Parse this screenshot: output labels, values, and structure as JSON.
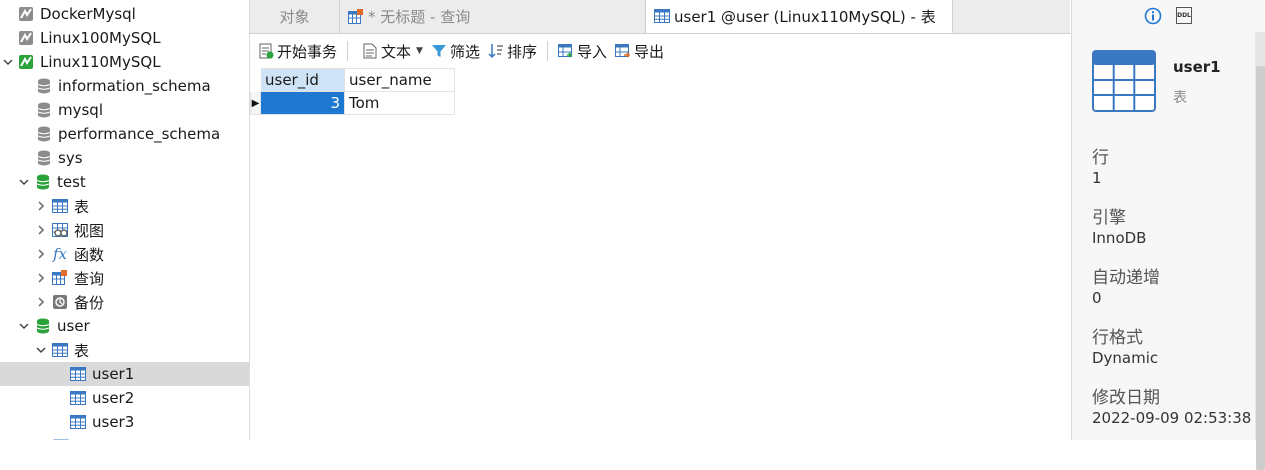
{
  "sidebar": {
    "connections": [
      {
        "label": "DockerMysql"
      },
      {
        "label": "Linux100MySQL"
      },
      {
        "label": "Linux110MySQL"
      }
    ],
    "databases": [
      {
        "label": "information_schema"
      },
      {
        "label": "mysql"
      },
      {
        "label": "performance_schema"
      },
      {
        "label": "sys"
      },
      {
        "label": "test"
      }
    ],
    "test_children": [
      {
        "label": "表"
      },
      {
        "label": "视图"
      },
      {
        "label": "函数"
      },
      {
        "label": "查询"
      },
      {
        "label": "备份"
      }
    ],
    "user_db": {
      "label": "user"
    },
    "user_tables_folder": {
      "label": "表"
    },
    "user_tables": [
      {
        "label": "user1"
      },
      {
        "label": "user2"
      },
      {
        "label": "user3"
      }
    ],
    "function_glyph": "fx"
  },
  "tabs": {
    "objects": "对象",
    "query": "* 无标题 - 查询",
    "table": "user1 @user (Linux110MySQL) - 表"
  },
  "toolbar": {
    "begin_transaction": "开始事务",
    "text": "文本",
    "filter": "筛选",
    "sort": "排序",
    "import": "导入",
    "export": "导出"
  },
  "grid": {
    "columns": [
      "user_id",
      "user_name"
    ],
    "rows": [
      {
        "user_id": "3",
        "user_name": "Tom"
      }
    ]
  },
  "info": {
    "object_name": "user1",
    "object_type": "表",
    "ddl_tab": "DDL",
    "properties": [
      {
        "label": "行",
        "value": "1"
      },
      {
        "label": "引擎",
        "value": "InnoDB"
      },
      {
        "label": "自动递增",
        "value": "0"
      },
      {
        "label": "行格式",
        "value": "Dynamic"
      },
      {
        "label": "修改日期",
        "value": "2022-09-09 02:53:38"
      }
    ]
  },
  "colors": {
    "accent": "#1e78d2",
    "db_green": "#2aa33a",
    "table_blue": "#3a78c2",
    "selection_gray": "#d9d9d9"
  }
}
